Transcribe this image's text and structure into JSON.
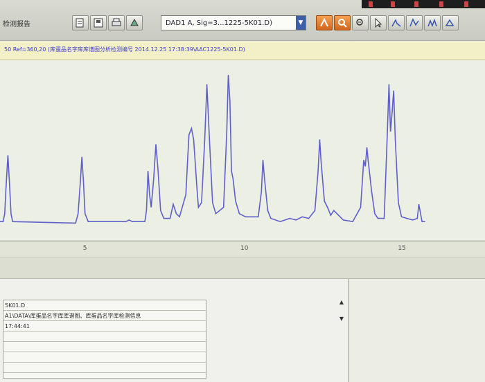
{
  "toolbar": {
    "left_label": "检测报告",
    "signal_select": "DAD1 A, Sig=3...1225-5K01.D)",
    "buttons": [
      "open-file",
      "save-file",
      "print",
      "export",
      "zoom-in",
      "zoom-out",
      "select-arrow",
      "peak-integrate-1",
      "peak-integrate-2",
      "peak-integrate-3",
      "peak-integrate-4"
    ]
  },
  "chromatogram": {
    "title": "50 Ref=360,20 (库蛋品名字库库谱图分析检测编号 2014.12.25 17:38:39\\AAC1225-5K01.D)",
    "trace_color": "#5f5fc9",
    "x_ticks": [
      "5",
      "10",
      "15"
    ]
  },
  "chart_data": {
    "type": "line",
    "title": "",
    "xlabel": "",
    "ylabel": "",
    "xlim": [
      2.3,
      17.7
    ],
    "ylim": [
      0,
      100
    ],
    "x_ticks": [
      5,
      10,
      15
    ],
    "series": [
      {
        "values": [
          [
            2.3,
            3
          ],
          [
            2.4,
            3
          ],
          [
            2.45,
            8
          ],
          [
            2.5,
            28
          ],
          [
            2.55,
            45
          ],
          [
            2.6,
            28
          ],
          [
            2.65,
            8
          ],
          [
            2.7,
            3
          ],
          [
            4.7,
            2
          ],
          [
            4.78,
            8
          ],
          [
            4.85,
            28
          ],
          [
            4.9,
            44
          ],
          [
            4.95,
            28
          ],
          [
            5.0,
            8
          ],
          [
            5.1,
            3
          ],
          [
            6.3,
            3
          ],
          [
            6.4,
            4
          ],
          [
            6.5,
            3
          ],
          [
            6.8,
            3
          ],
          [
            6.9,
            3
          ],
          [
            6.95,
            10
          ],
          [
            7.0,
            35
          ],
          [
            7.05,
            20
          ],
          [
            7.1,
            12
          ],
          [
            7.18,
            30
          ],
          [
            7.25,
            52
          ],
          [
            7.32,
            35
          ],
          [
            7.4,
            10
          ],
          [
            7.5,
            5
          ],
          [
            7.7,
            5
          ],
          [
            7.8,
            14
          ],
          [
            7.9,
            8
          ],
          [
            8.0,
            6
          ],
          [
            8.2,
            20
          ],
          [
            8.3,
            58
          ],
          [
            8.38,
            62
          ],
          [
            8.45,
            55
          ],
          [
            8.55,
            25
          ],
          [
            8.6,
            12
          ],
          [
            8.7,
            15
          ],
          [
            8.8,
            55
          ],
          [
            8.87,
            90
          ],
          [
            8.95,
            55
          ],
          [
            9.05,
            15
          ],
          [
            9.15,
            8
          ],
          [
            9.4,
            12
          ],
          [
            9.5,
            60
          ],
          [
            9.55,
            96
          ],
          [
            9.6,
            80
          ],
          [
            9.65,
            35
          ],
          [
            9.7,
            30
          ],
          [
            9.78,
            16
          ],
          [
            9.9,
            8
          ],
          [
            10.1,
            6
          ],
          [
            10.5,
            6
          ],
          [
            10.6,
            22
          ],
          [
            10.65,
            42
          ],
          [
            10.7,
            30
          ],
          [
            10.8,
            10
          ],
          [
            10.9,
            5
          ],
          [
            11.2,
            3
          ],
          [
            11.5,
            5
          ],
          [
            11.7,
            4
          ],
          [
            11.9,
            6
          ],
          [
            12.1,
            5
          ],
          [
            12.3,
            10
          ],
          [
            12.4,
            35
          ],
          [
            12.45,
            55
          ],
          [
            12.5,
            40
          ],
          [
            12.6,
            16
          ],
          [
            12.7,
            12
          ],
          [
            12.8,
            7
          ],
          [
            12.9,
            10
          ],
          [
            13.0,
            8
          ],
          [
            13.2,
            4
          ],
          [
            13.5,
            3
          ],
          [
            13.75,
            12
          ],
          [
            13.85,
            42
          ],
          [
            13.9,
            38
          ],
          [
            13.95,
            50
          ],
          [
            14.0,
            40
          ],
          [
            14.1,
            22
          ],
          [
            14.2,
            8
          ],
          [
            14.3,
            5
          ],
          [
            14.5,
            5
          ],
          [
            14.6,
            60
          ],
          [
            14.65,
            90
          ],
          [
            14.7,
            60
          ],
          [
            14.75,
            72
          ],
          [
            14.8,
            86
          ],
          [
            14.85,
            55
          ],
          [
            14.95,
            15
          ],
          [
            15.05,
            6
          ],
          [
            15.4,
            4
          ],
          [
            15.55,
            5
          ],
          [
            15.6,
            14
          ],
          [
            15.7,
            3
          ],
          [
            15.8,
            3
          ]
        ]
      }
    ],
    "grid": false,
    "legend": "none"
  },
  "report": {
    "rows": [
      "5K01.D",
      "A1\\DATA\\库蛋品名字库库谱图、库蛋品名字库检测信息",
      "17:44:41",
      "",
      "",
      "",
      ""
    ],
    "scroll_up": "▲",
    "scroll_down": "▼"
  }
}
